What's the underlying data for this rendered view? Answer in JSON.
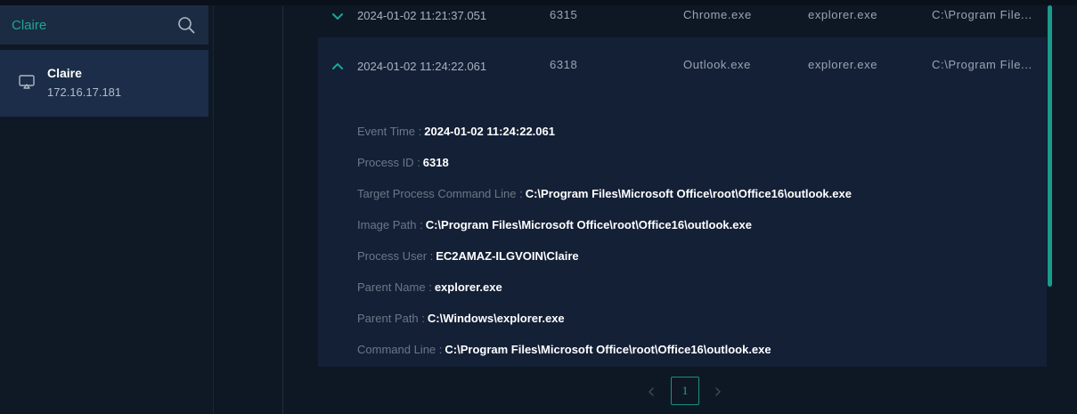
{
  "search": {
    "value": "Claire"
  },
  "host": {
    "name": "Claire",
    "ip": "172.16.17.181"
  },
  "rows": [
    {
      "time": "2024-01-02 11:21:37.051",
      "pid": "6315",
      "process": "Chrome.exe",
      "parent": "explorer.exe",
      "path": "C:\\Program File..."
    },
    {
      "time": "2024-01-02 11:24:22.061",
      "pid": "6318",
      "process": "Outlook.exe",
      "parent": "explorer.exe",
      "path": "C:\\Program File..."
    }
  ],
  "details": {
    "event_time": {
      "label": "Event Time :",
      "value": "2024-01-02 11:24:22.061"
    },
    "process_id": {
      "label": "Process ID :",
      "value": "6318"
    },
    "target_cmd": {
      "label": "Target Process Command Line :",
      "value": "C:\\Program Files\\Microsoft Office\\root\\Office16\\outlook.exe"
    },
    "image_path": {
      "label": "Image Path :",
      "value": "C:\\Program Files\\Microsoft Office\\root\\Office16\\outlook.exe"
    },
    "process_user": {
      "label": "Process User :",
      "value": "EC2AMAZ-ILGVOIN\\Claire"
    },
    "parent_name": {
      "label": "Parent Name :",
      "value": "explorer.exe"
    },
    "parent_path": {
      "label": "Parent Path :",
      "value": "C:\\Windows\\explorer.exe"
    },
    "command_line": {
      "label": "Command Line :",
      "value": "C:\\Program Files\\Microsoft Office\\root\\Office16\\outlook.exe"
    }
  },
  "pagination": {
    "current": "1"
  },
  "colors": {
    "accent": "#1fa596",
    "panel": "#1b2d48",
    "background": "#0e1825"
  },
  "icons": [
    "search-icon",
    "monitor-icon",
    "chevron-down-icon",
    "chevron-up-icon",
    "chevron-left-icon",
    "chevron-right-icon"
  ]
}
